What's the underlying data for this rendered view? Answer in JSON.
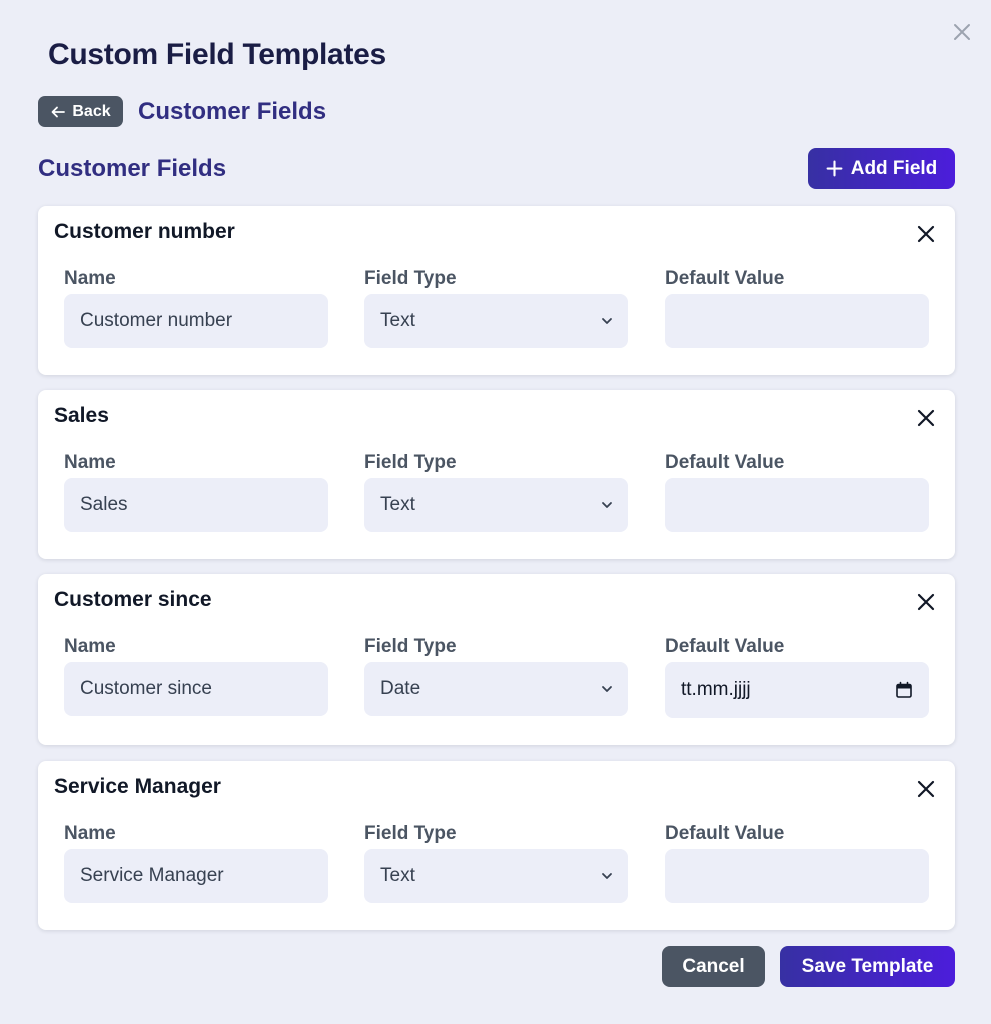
{
  "modal": {
    "title": "Custom Field Templates"
  },
  "header": {
    "back_label": "Back",
    "breadcrumb_title": "Customer Fields"
  },
  "section": {
    "title": "Customer Fields",
    "add_field_label": "Add Field"
  },
  "labels": {
    "name": "Name",
    "field_type": "Field Type",
    "default_value": "Default Value"
  },
  "fields": [
    {
      "title": "Customer number",
      "name": "Customer number",
      "type": "Text",
      "default": ""
    },
    {
      "title": "Sales",
      "name": "Sales",
      "type": "Text",
      "default": ""
    },
    {
      "title": "Customer since",
      "name": "Customer since",
      "type": "Date",
      "default": "tt.mm.jjjj"
    },
    {
      "title": "Service Manager",
      "name": "Service Manager",
      "type": "Text",
      "default": ""
    }
  ],
  "footer": {
    "cancel_label": "Cancel",
    "save_label": "Save Template"
  },
  "colors": {
    "accent": "#3730A3",
    "accent_end": "#4C1DDB",
    "heading": "#312E81",
    "neutral_button": "#4B5563"
  },
  "icons": {
    "close": "close-icon",
    "back": "arrow-left-icon",
    "add": "plus-icon",
    "dropdown": "chevron-down-icon",
    "calendar": "calendar-icon"
  }
}
